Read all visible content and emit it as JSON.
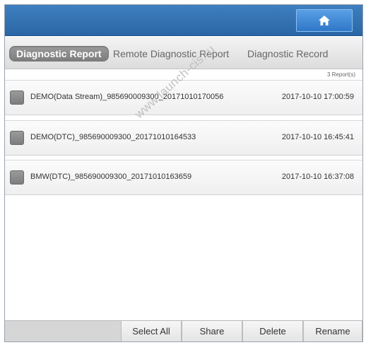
{
  "header": {
    "home_icon": "home-icon"
  },
  "tabs": [
    {
      "label": "Diagnostic Report",
      "active": true
    },
    {
      "label": "Remote Diagnostic Report",
      "active": false
    },
    {
      "label": "Diagnostic Record",
      "active": false
    }
  ],
  "list": {
    "count_label": "3 Report(s)",
    "items": [
      {
        "name": "DEMO(Data Stream)_985690009300_20171010170056",
        "time": "2017-10-10 17:00:59",
        "checked": false
      },
      {
        "name": "DEMO(DTC)_985690009300_20171010164533",
        "time": "2017-10-10 16:45:41",
        "checked": false
      },
      {
        "name": "BMW(DTC)_985690009300_20171010163659",
        "time": "2017-10-10 16:37:08",
        "checked": false
      }
    ]
  },
  "watermark": "www.launch-cis.ru",
  "toolbar": {
    "select_all": "Select All",
    "share": "Share",
    "delete": "Delete",
    "rename": "Rename"
  },
  "colors": {
    "header": "#2a66a6",
    "home_button": "#3a86d6",
    "active_tab": "#8a8a8a"
  }
}
